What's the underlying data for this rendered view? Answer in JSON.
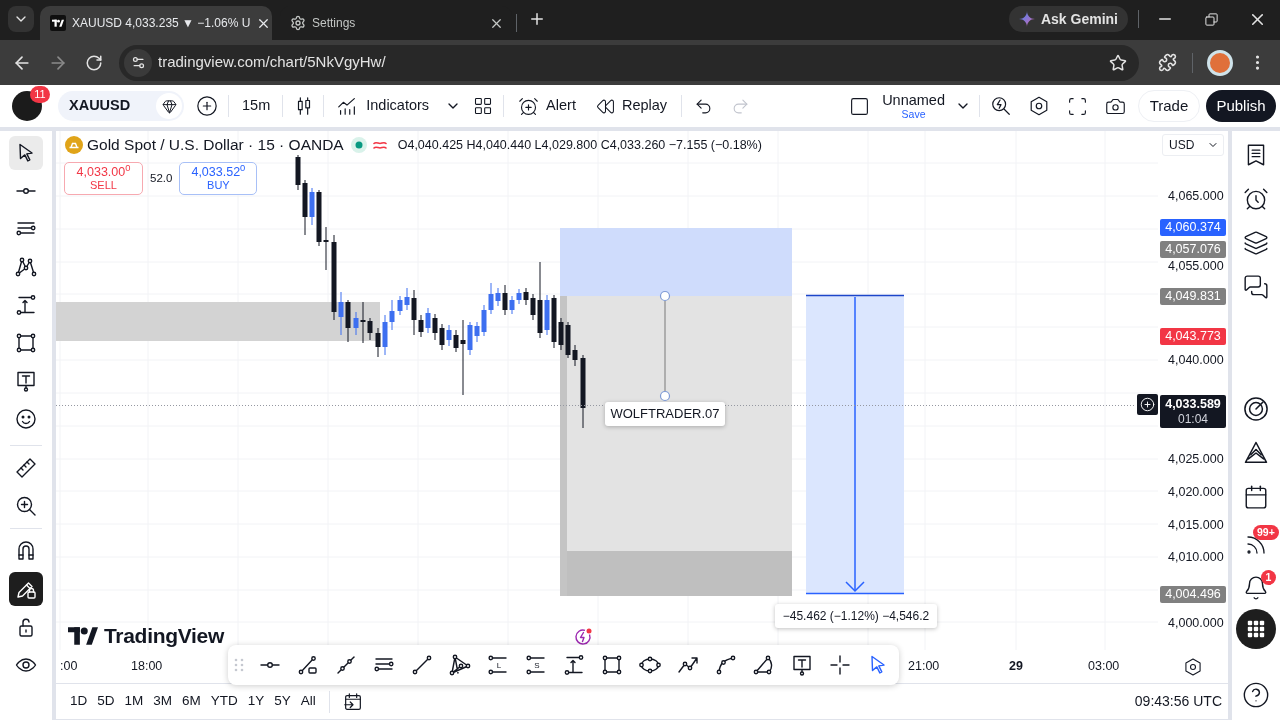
{
  "browser": {
    "tabs": [
      {
        "kind": "chart",
        "title": "XAUUSD 4,033.235 ▼ −1.06% U",
        "selected": true
      },
      {
        "kind": "settings",
        "title": "Settings",
        "selected": false
      }
    ],
    "assistant_button": "Ask Gemini",
    "url": "tradingview.com/chart/5NkVgyHw/"
  },
  "header": {
    "notifications": "11",
    "symbol": "XAUUSD",
    "interval": "15m",
    "indicators": "Indicators",
    "alert": "Alert",
    "replay": "Replay",
    "history": [
      {
        "kind": "undo",
        "disabled": false
      },
      {
        "kind": "redo",
        "disabled": true
      }
    ],
    "layout_name": "Unnamed",
    "save": "Save",
    "trade": "Trade",
    "publish": "Publish"
  },
  "left_toolbar": {
    "tools": [
      {
        "kind": "cursor",
        "selected": true
      },
      {
        "kind": "ray",
        "selected": false
      },
      {
        "kind": "fib",
        "selected": false
      },
      {
        "kind": "pattern",
        "selected": false
      },
      {
        "kind": "projection",
        "selected": false
      },
      {
        "kind": "rectangle",
        "selected": false
      },
      {
        "kind": "text",
        "selected": false
      },
      {
        "kind": "emoji",
        "selected": false
      },
      {
        "kind": "ruler",
        "selected": false
      },
      {
        "kind": "zoom",
        "selected": false
      }
    ],
    "toggles": [
      {
        "kind": "magnet",
        "on": false
      },
      {
        "kind": "drawing-lock",
        "on": true
      },
      {
        "kind": "lock",
        "on": false
      },
      {
        "kind": "visibility",
        "on": false
      }
    ]
  },
  "chart": {
    "legend": {
      "title": "Gold Spot / U.S. Dollar · 15 · OANDA",
      "ohlc": "O4,040.425 H4,040.440 L4,029.800 C4,033.260 −7.155 (−0.18%)"
    },
    "sell": {
      "price": "4,033.00$^{0}$",
      "label": "SELL"
    },
    "spread": "52.0",
    "buy": {
      "price": "4,033.52$^{0}$",
      "label": "BUY"
    },
    "currency": "USD",
    "price_ticks": [
      "4,065.000",
      "4,055.000",
      "4,040.000",
      "4,025.000",
      "4,020.000",
      "4,015.000",
      "4,010.000",
      "4,000.000"
    ],
    "price_labels": [
      {
        "text": "4,060.374",
        "color": "#2962ff"
      },
      {
        "text": "4,057.076",
        "color": "#808080"
      },
      {
        "text": "4,049.831",
        "color": "#808080"
      },
      {
        "text": "4,043.773",
        "color": "#f23645"
      },
      {
        "text": "4,004.496",
        "color": "#808080"
      }
    ],
    "last_price": {
      "price": "4,033.589",
      "countdown": "01:04"
    },
    "drawing_label": "WOLFTRADER.07",
    "measure_label": "−45.462 (−1.12%) −4,546.2",
    "logo_text": "TradingView",
    "time_ticks": [
      {
        "text": ":00",
        "kind": "time"
      },
      {
        "text": "18:00",
        "kind": "time"
      },
      {
        "text": "21:00",
        "kind": "time"
      },
      {
        "text": "29",
        "kind": "date"
      },
      {
        "text": "03:00",
        "kind": "time"
      }
    ]
  },
  "drawing_toolbar": {
    "tools": [
      {
        "kind": "ray",
        "selected": false
      },
      {
        "kind": "trend-box",
        "selected": false
      },
      {
        "kind": "channel",
        "selected": false
      },
      {
        "kind": "fib",
        "selected": false
      },
      {
        "kind": "trend-line",
        "selected": false
      },
      {
        "kind": "triangle",
        "selected": false
      },
      {
        "kind": "long",
        "letter": "L",
        "selected": false
      },
      {
        "kind": "short",
        "letter": "S",
        "selected": false
      },
      {
        "kind": "projection",
        "selected": false
      },
      {
        "kind": "rectangle",
        "selected": false
      },
      {
        "kind": "ellipse",
        "selected": false
      },
      {
        "kind": "path",
        "selected": false
      },
      {
        "kind": "curve",
        "selected": false
      },
      {
        "kind": "arc",
        "selected": false
      },
      {
        "kind": "text",
        "selected": false
      },
      {
        "kind": "crosshair",
        "selected": false
      },
      {
        "kind": "cursor",
        "selected": true
      }
    ]
  },
  "right_sidebar": {
    "feed_badge": "99+",
    "alerts_badge": "1"
  },
  "bottom_bar": {
    "ranges": [
      "1D",
      "5D",
      "1M",
      "3M",
      "6M",
      "YTD",
      "1Y",
      "5Y",
      "All"
    ],
    "clock": "09:43:56 UTC"
  }
}
